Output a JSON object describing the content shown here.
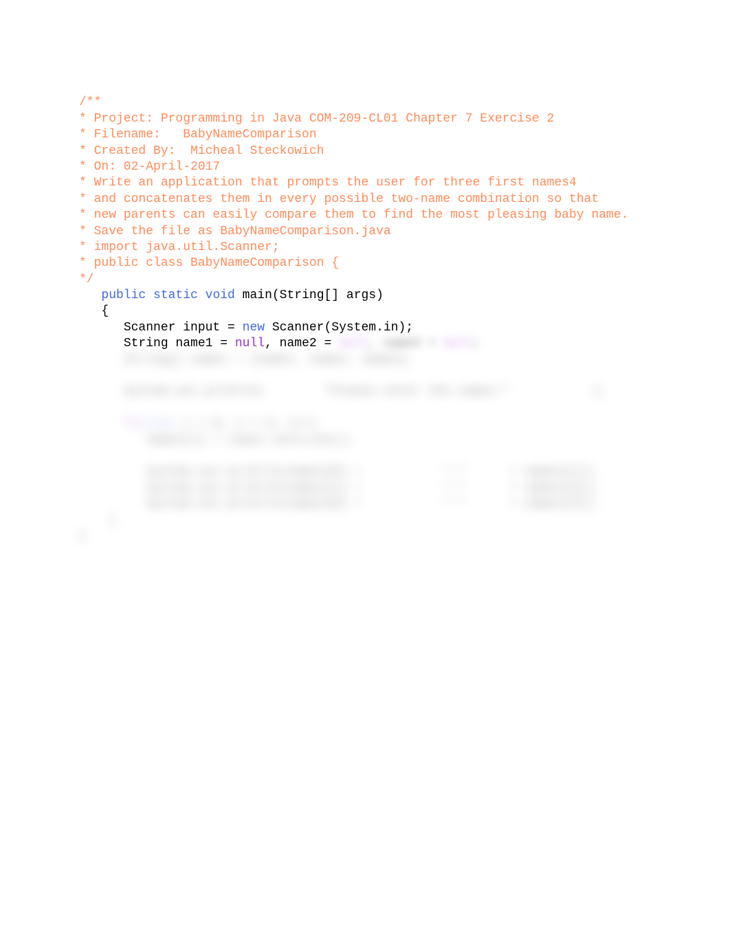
{
  "code": {
    "comment_lines": [
      "/**",
      "* Project: Programming in Java COM-209-CL01 Chapter 7 Exercise 2",
      "* Filename:   BabyNameComparison",
      "* Created By:  Micheal Steckowich",
      "* On: 02-April-2017",
      "* Write an application that prompts the user for three first names4",
      "* and concatenates them in every possible two-name combination so that",
      "* new parents can easily compare them to find the most pleasing baby name.",
      "* Save the file as BabyNameComparison.java",
      "* import java.util.Scanner;",
      "* public class BabyNameComparison {",
      "*/"
    ],
    "method_signature": {
      "indent": "   ",
      "kw_public": "public",
      "kw_static": "static",
      "kw_void": "void",
      "rest": " main(String[] args)"
    },
    "brace_open": "   {",
    "scanner_line": {
      "indent": "      ",
      "prefix": "Scanner input = ",
      "kw_new": "new",
      "suffix": " Scanner(System.in);"
    },
    "string_line": {
      "indent": "      ",
      "prefix": "String name1 = ",
      "null1": "null",
      "mid": ", name2 = "
    },
    "blurred": {
      "null2": "null",
      "name3": ", name3 = ",
      "null3": "null",
      "semi": ";",
      "array_line": "String[] names = {name1, name2, name3};",
      "println_line": "System.out.println(        \"Please enter the names:\"           );",
      "for_kw": "for",
      "int_kw": "(int",
      "for_rest": " i = 0; i < 3; i++)",
      "next_line": "names[i] = input.nextLine();",
      "out1": "System.out.println(names[0] +           \" \"      + names[1]);",
      "out2": "System.out.println(names[1] +           \" \"      + names[2]);",
      "out3": "System.out.println(names[0] +           \" \"      + names[2]);",
      "brace_close1": "    }",
      "brace_close2": "}"
    }
  }
}
